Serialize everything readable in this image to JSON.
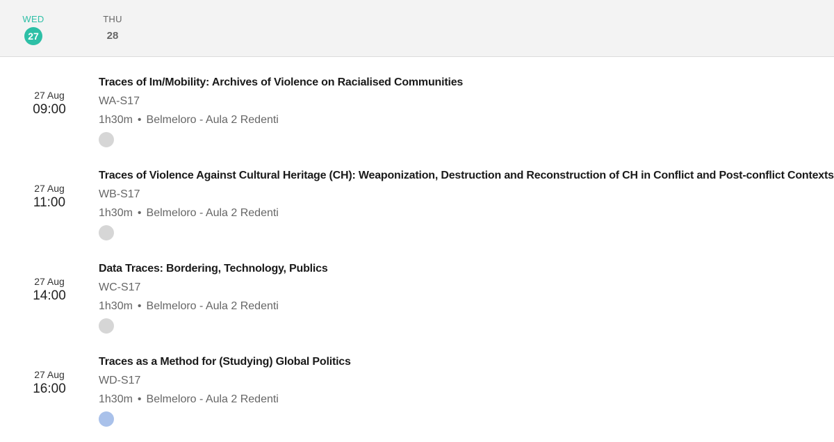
{
  "days": [
    {
      "dow": "WED",
      "num": "27",
      "active": true
    },
    {
      "dow": "THU",
      "num": "28",
      "active": false
    }
  ],
  "sessions": [
    {
      "date": "27 Aug",
      "time": "09:00",
      "title": "Traces of Im/Mobility: Archives of Violence on Racialised Communities",
      "code": "WA-S17",
      "duration": "1h30m",
      "separator": "•",
      "location": "Belmeloro - Aula 2 Redenti",
      "avatar_color": "#d6d6d6"
    },
    {
      "date": "27 Aug",
      "time": "11:00",
      "title": "Traces of Violence Against Cultural Heritage (CH): Weaponization, Destruction and Reconstruction of CH in Conflict and Post-conflict Contexts",
      "code": "WB-S17",
      "duration": "1h30m",
      "separator": "•",
      "location": "Belmeloro - Aula 2 Redenti",
      "avatar_color": "#d6d6d6"
    },
    {
      "date": "27 Aug",
      "time": "14:00",
      "title": "Data Traces: Bordering, Technology, Publics",
      "code": "WC-S17",
      "duration": "1h30m",
      "separator": "•",
      "location": "Belmeloro - Aula 2 Redenti",
      "avatar_color": "#d6d6d6"
    },
    {
      "date": "27 Aug",
      "time": "16:00",
      "title": "Traces as a Method for (Studying) Global Politics",
      "code": "WD-S17",
      "duration": "1h30m",
      "separator": "•",
      "location": "Belmeloro - Aula 2 Redenti",
      "avatar_color": "#a9c1ea"
    }
  ]
}
